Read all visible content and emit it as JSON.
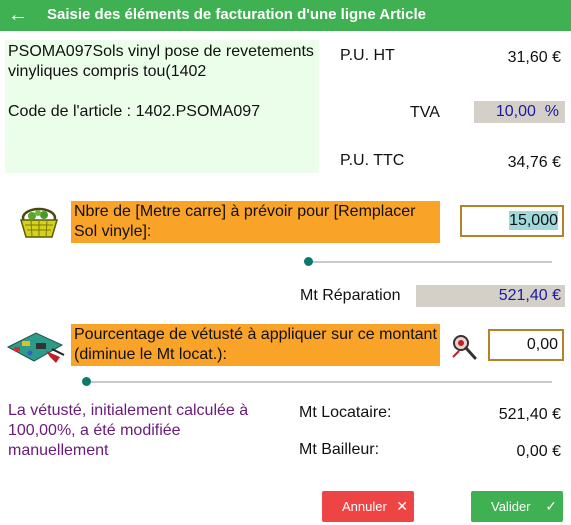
{
  "header": {
    "back_icon": "arrow-left-icon",
    "title": "Saisie des éléments de facturation d'une ligne Article"
  },
  "article": {
    "description": "PSOMA097Sols vinyl  pose de revetements vinyliques compris tou(1402",
    "code_line": "Code de l'article : 1402.PSOMA097"
  },
  "pricing": {
    "pu_ht_label": "P.U. HT",
    "pu_ht_value": "31,60 €",
    "tva_label": "TVA",
    "tva_value": "10,00  %",
    "pu_ttc_label": "P.U. TTC",
    "pu_ttc_value": "34,76 €"
  },
  "quantity": {
    "icon": "basket-icon",
    "label": "Nbre de [Metre carre] à prévoir pour [Remplacer Sol vinyle]:",
    "value": "15,000",
    "slider_fraction": 0
  },
  "reparation": {
    "label": "Mt Réparation",
    "value": "521,40 €"
  },
  "vetuste": {
    "icon": "circuit-board-icon",
    "label": "Pourcentage de vétusté à appliquer sur ce montant (diminue le Mt locat.):",
    "zoom_icon": "magnifier-icon",
    "value": "0,00",
    "slider_fraction": 0
  },
  "note": "La vétusté, initialement calculée à 100,00%, a été modifiée manuellement",
  "totals": {
    "locataire_label": "Mt Locataire:",
    "locataire_value": "521,40 €",
    "bailleur_label": "Mt Bailleur:",
    "bailleur_value": "0,00 €"
  },
  "buttons": {
    "cancel_label": "Annuler",
    "cancel_icon": "close-icon",
    "ok_label": "Valider",
    "ok_icon": "check-icon"
  },
  "colors": {
    "header_green": "#3fb153",
    "label_orange": "#f9a328",
    "readonly_grey": "#d4d0c8",
    "cancel_red": "#ef4444",
    "note_purple": "#6a1a7a"
  }
}
